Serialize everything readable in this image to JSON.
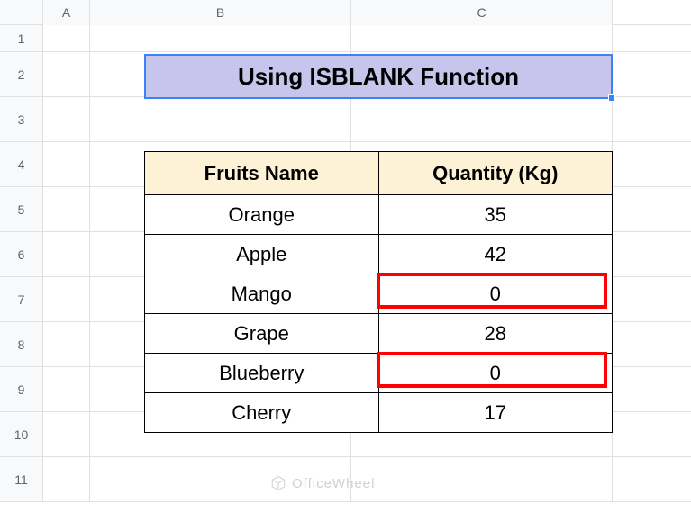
{
  "columns": [
    "A",
    "B",
    "C"
  ],
  "rows": [
    "1",
    "2",
    "3",
    "4",
    "5",
    "6",
    "7",
    "8",
    "9",
    "10",
    "11"
  ],
  "title": "Using ISBLANK Function",
  "table": {
    "headers": [
      "Fruits Name",
      "Quantity (Kg)"
    ],
    "data": [
      {
        "name": "Orange",
        "qty": "35",
        "highlight": false
      },
      {
        "name": "Apple",
        "qty": "42",
        "highlight": false
      },
      {
        "name": "Mango",
        "qty": "0",
        "highlight": true
      },
      {
        "name": "Grape",
        "qty": "28",
        "highlight": false
      },
      {
        "name": "Blueberry",
        "qty": "0",
        "highlight": true
      },
      {
        "name": "Cherry",
        "qty": "17",
        "highlight": false
      }
    ]
  },
  "watermark": "OfficeWheel",
  "chart_data": {
    "type": "table",
    "title": "Using ISBLANK Function",
    "columns": [
      "Fruits Name",
      "Quantity (Kg)"
    ],
    "rows": [
      [
        "Orange",
        35
      ],
      [
        "Apple",
        42
      ],
      [
        "Mango",
        0
      ],
      [
        "Grape",
        28
      ],
      [
        "Blueberry",
        0
      ],
      [
        "Cherry",
        17
      ]
    ],
    "highlighted_rows": [
      2,
      4
    ]
  }
}
